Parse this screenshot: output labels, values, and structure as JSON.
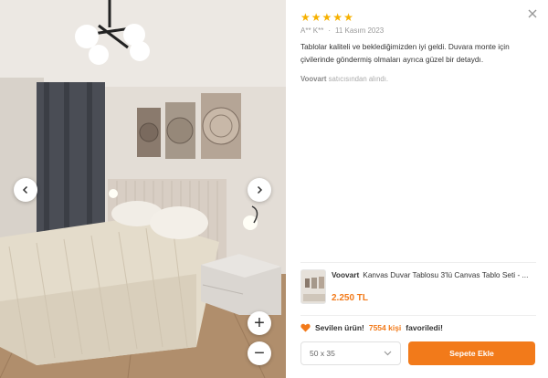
{
  "review": {
    "stars": [
      "★",
      "★",
      "★",
      "★",
      "★"
    ],
    "author": "A** K**",
    "separator": "·",
    "date": "11 Kasım 2023",
    "comment": "Tablolar kaliteli ve beklediğimizden iyi geldi. Duvara monte için çivilerinde göndermiş olmaları ayrıca güzel bir detaydı.",
    "seller_name": "Voovart",
    "seller_suffix": "satıcısından alındı."
  },
  "product": {
    "brand": "Voovart",
    "title": "Kanvas Duvar Tablosu 3'lü Canvas Tablo Seti - ...",
    "price": "2.250 TL"
  },
  "favorite": {
    "prefix": "Sevilen ürün!",
    "count": "7554 kişi",
    "suffix": "favoriledi!"
  },
  "size_select": {
    "value": "50 x 35"
  },
  "cart_button": {
    "label": "Sepete Ekle"
  },
  "zoom": {
    "plus": "+",
    "minus": "−"
  },
  "colors": {
    "accent": "#f27a1a",
    "star": "#f6b100"
  },
  "icons": [
    "close-icon",
    "chevron-left-icon",
    "chevron-right-icon",
    "heart-icon",
    "chevron-down-icon",
    "star-icon"
  ]
}
